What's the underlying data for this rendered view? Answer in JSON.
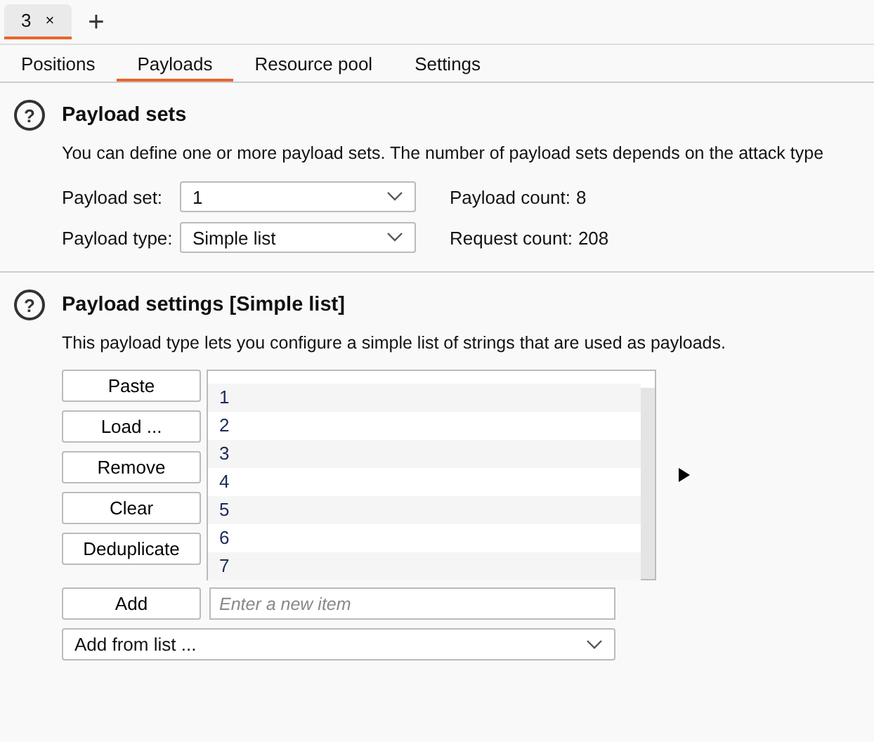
{
  "document_tabs": [
    {
      "label": "3",
      "close": "×",
      "selected": true
    }
  ],
  "new_tab": "+",
  "tabs": [
    {
      "label": "Positions",
      "selected": false
    },
    {
      "label": "Payloads",
      "selected": true
    },
    {
      "label": "Resource pool",
      "selected": false
    },
    {
      "label": "Settings",
      "selected": false
    }
  ],
  "payload_sets": {
    "help": "?",
    "title": "Payload sets",
    "description": "You can define one or more payload sets. The number of payload sets depends on the attack type",
    "fields": [
      {
        "label": "Payload set:",
        "value": "1",
        "info_label": "Payload count:",
        "info_value": "8"
      },
      {
        "label": "Payload type:",
        "value": "Simple list",
        "info_label": "Request count:",
        "info_value": "208"
      }
    ]
  },
  "payload_settings": {
    "help": "?",
    "title": "Payload settings [Simple list]",
    "description": "This payload type lets you configure a simple list of strings that are used as payloads.",
    "buttons": [
      "Paste",
      "Load ...",
      "Remove",
      "Clear",
      "Deduplicate"
    ],
    "items": [
      "1",
      "2",
      "3",
      "4",
      "5",
      "6",
      "7"
    ],
    "add_button": "Add",
    "new_item": {
      "placeholder": "Enter a new item"
    },
    "add_from_list": "Add from list ..."
  }
}
